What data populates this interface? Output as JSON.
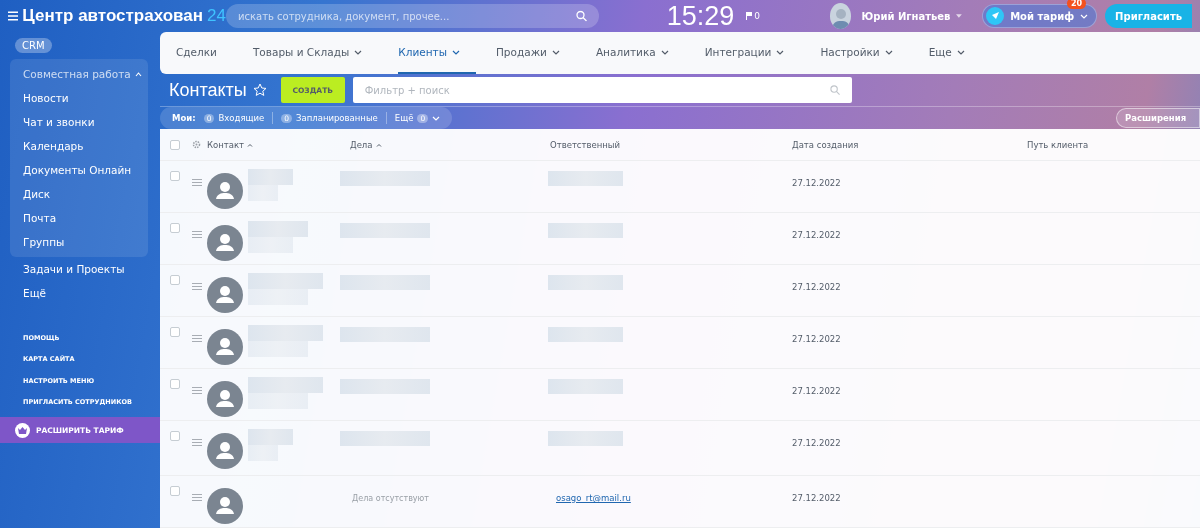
{
  "header": {
    "logo": "Центр автострахован",
    "logo_suffix": "24",
    "search": {
      "placeholder": "искать сотрудника, документ, прочее..."
    },
    "clock": "15:29",
    "flags": "0",
    "user": "Юрий Игнатьев",
    "tariff": {
      "label": "Мой тариф",
      "badge": "20"
    },
    "invite": "Пригласить"
  },
  "sidebar": {
    "badge": "CRM",
    "group": {
      "label": "Совместная работа",
      "expanded": true,
      "items": [
        "Новости",
        "Чат и звонки",
        "Календарь",
        "Документы Онлайн",
        "Диск",
        "Почта",
        "Группы"
      ]
    },
    "items": [
      "Задачи и Проекты",
      "Ещё"
    ],
    "links": [
      "ПОМОЩЬ",
      "КАРТА САЙТА",
      "НАСТРОИТЬ МЕНЮ",
      "ПРИГЛАСИТЬ СОТРУДНИКОВ"
    ],
    "upgrade": "РАСШИРИТЬ ТАРИФ"
  },
  "nav": [
    {
      "label": "Сделки",
      "dropdown": false,
      "selected": false
    },
    {
      "label": "Товары и Склады",
      "dropdown": true,
      "selected": false
    },
    {
      "label": "Клиенты",
      "dropdown": true,
      "selected": true
    },
    {
      "label": "Продажи",
      "dropdown": true,
      "selected": false
    },
    {
      "label": "Аналитика",
      "dropdown": true,
      "selected": false
    },
    {
      "label": "Интеграции",
      "dropdown": true,
      "selected": false
    },
    {
      "label": "Настройки",
      "dropdown": true,
      "selected": false
    },
    {
      "label": "Еще",
      "dropdown": true,
      "selected": false
    }
  ],
  "page": {
    "title": "Контакты",
    "create": "СОЗДАТЬ",
    "filter": {
      "placeholder": "Фильтр + поиск"
    }
  },
  "counters": {
    "label": "Мои:",
    "items": [
      {
        "count": "0",
        "label": "Входящие"
      },
      {
        "count": "0",
        "label": "Запланированные"
      }
    ],
    "more": {
      "label": "Ещё",
      "count": "0"
    },
    "extensions": "Расширения"
  },
  "table": {
    "all_checked": false,
    "columns": [
      "Контакт",
      "Дела",
      "Ответственный",
      "Дата создания",
      "Путь клиента"
    ],
    "sorted": [
      true,
      true,
      false,
      false,
      false
    ],
    "rows": [
      {
        "checked": false,
        "date": "27.12.2022"
      },
      {
        "checked": false,
        "date": "27.12.2022"
      },
      {
        "checked": false,
        "date": "27.12.2022"
      },
      {
        "checked": false,
        "date": "27.12.2022"
      },
      {
        "checked": false,
        "date": "27.12.2022"
      },
      {
        "checked": false,
        "date": "27.12.2022"
      },
      {
        "checked": false,
        "date": "27.12.2022",
        "deals": "Дела отсутствуют",
        "responsible": "osago_rt@mail.ru"
      }
    ]
  }
}
